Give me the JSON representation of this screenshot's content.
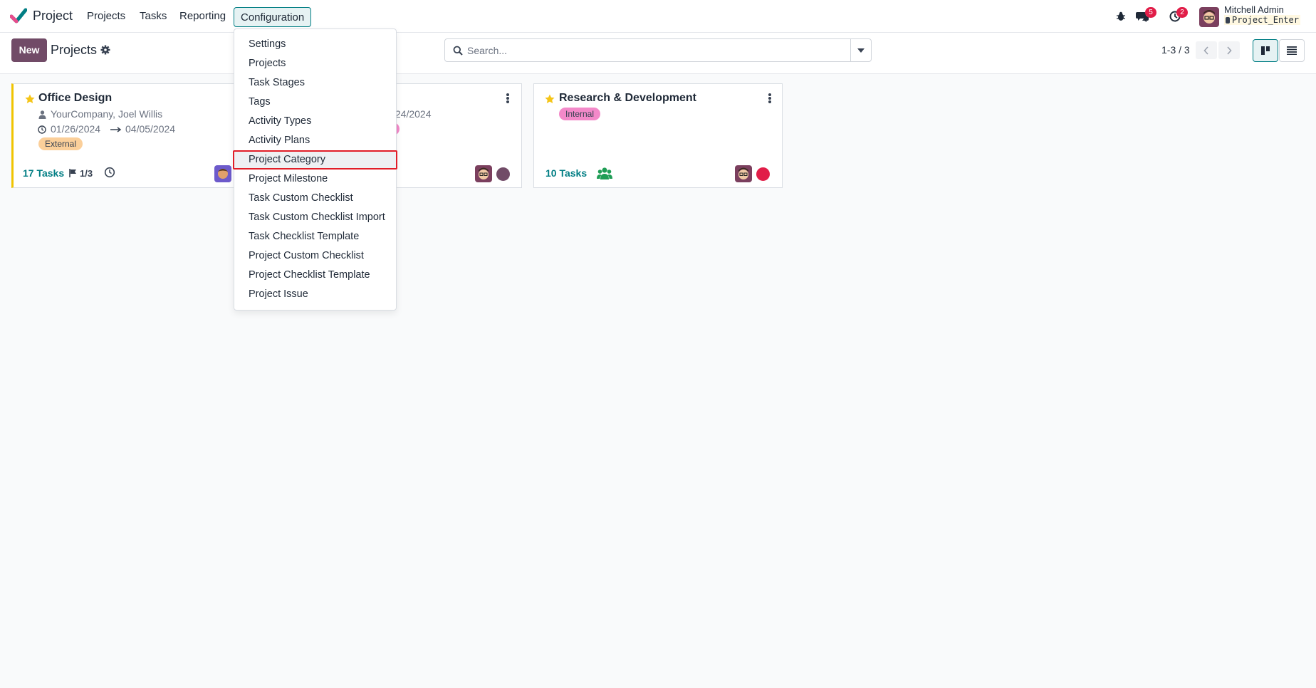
{
  "navbar": {
    "app_name": "Project",
    "menu": [
      "Projects",
      "Tasks",
      "Reporting",
      "Configuration"
    ],
    "messages_badge": "5",
    "activities_badge": "2",
    "user_name": "Mitchell Admin",
    "database": "Project_Enter"
  },
  "control_panel": {
    "new_label": "New",
    "title": "Projects",
    "search_placeholder": "Search...",
    "pager": "1-3 / 3"
  },
  "configuration_menu": {
    "items": [
      "Settings",
      "Projects",
      "Task Stages",
      "Tags",
      "Activity Types",
      "Activity Plans",
      "Project Category",
      "Project Milestone",
      "Task Custom Checklist",
      "Task Custom Checklist Import",
      "Task Checklist Template",
      "Project Custom Checklist",
      "Project Checklist Template",
      "Project Issue"
    ],
    "highlighted_index": 6
  },
  "cards": [
    {
      "title": "Office Design",
      "customer": "YourCompany, Joel Willis",
      "date_start": "01/26/2024",
      "date_end": "04/05/2024",
      "tag": "External",
      "tasks": "17 Tasks",
      "milestones": "1/3"
    },
    {
      "date_fragment": "/24/2024"
    },
    {
      "title": "Research & Development",
      "tag": "Internal",
      "tasks": "10 Tasks"
    }
  ],
  "colors": {
    "primary": "#714b67",
    "teal": "#017e84",
    "highlight_border": "#e11d28",
    "tag_external": "#fbcf9a",
    "tag_internal": "#f389c9",
    "status_red": "#e11d48",
    "status_purple": "#714b67"
  }
}
